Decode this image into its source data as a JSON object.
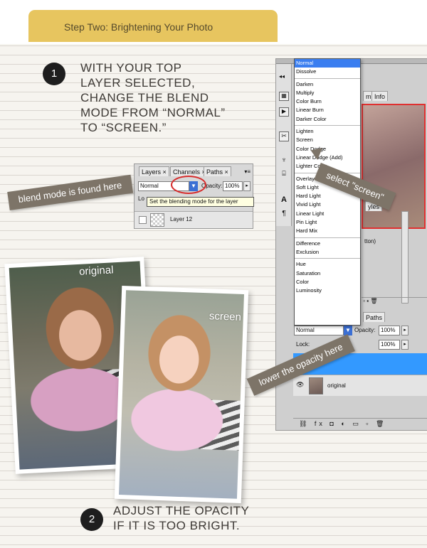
{
  "header": {
    "title": "Step Two: Brightening Your Photo"
  },
  "step1": {
    "number": "1",
    "text": "WITH YOUR TOP\nLAYER SELECTED,\nCHANGE THE BLEND\nMODE FROM “NORMAL”\nTO “SCREEN.”"
  },
  "step2": {
    "number": "2",
    "text": "ADJUST THE OPACITY\nIF IT IS TOO BRIGHT."
  },
  "layers_panel": {
    "tabs": [
      "Layers",
      "Channels",
      "Paths"
    ],
    "blend_mode": "Normal",
    "opacity_label": "Opacity:",
    "opacity_value": "100%",
    "lock_prefix": "Lo",
    "tooltip": "Set the blending mode for the layer",
    "layer_name": "Layer 12"
  },
  "callouts": {
    "blend_mode": "blend mode is found here",
    "select_screen": "select \"screen\"",
    "lower_opacity": "lower the opacity here"
  },
  "blend_menu": {
    "groups": [
      [
        "Normal",
        "Dissolve"
      ],
      [
        "Darken",
        "Multiply",
        "Color Burn",
        "Linear Burn",
        "Darker Color"
      ],
      [
        "Lighten",
        "Screen",
        "Color Dodge",
        "Linear Dodge (Add)",
        "Lighter Color"
      ],
      [
        "Overlay",
        "Soft Light",
        "Hard Light",
        "Vivid Light",
        "Linear Light",
        "Pin Light",
        "Hard Mix"
      ],
      [
        "Difference",
        "Exclusion"
      ],
      [
        "Hue",
        "Saturation",
        "Color",
        "Luminosity"
      ]
    ],
    "selected": "Normal"
  },
  "right_panel": {
    "top_tabs": [
      "m",
      "Info"
    ],
    "styles_tab": "yles",
    "tton_text": "tton)",
    "paths_tab": "Paths",
    "blend_mode": "Normal",
    "opacity_label": "Opacity:",
    "opacity_value": "100%",
    "lock_label": "Lock:",
    "fill_value": "100%",
    "layer_name": "original"
  },
  "photos": {
    "original_label": "original",
    "screen_label": "screen"
  }
}
